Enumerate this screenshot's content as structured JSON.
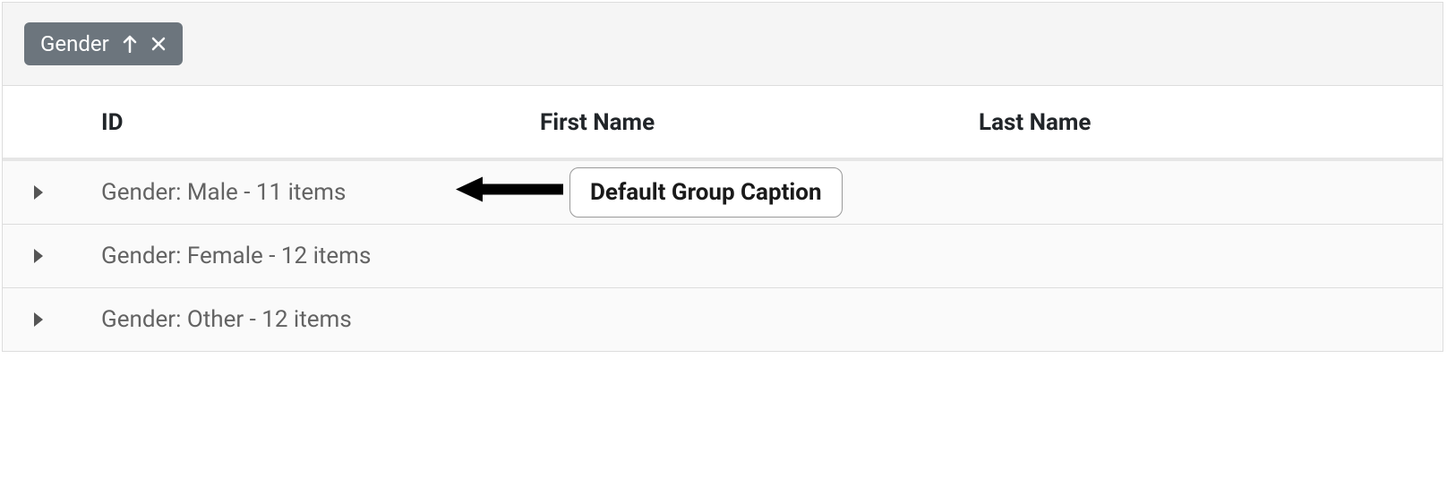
{
  "group_panel": {
    "chip": {
      "label": "Gender",
      "sort_icon": "arrow-up",
      "remove_icon": "close"
    }
  },
  "columns": {
    "id": "ID",
    "first_name": "First Name",
    "last_name": "Last Name"
  },
  "groups": [
    {
      "caption": "Gender: Male - 11 items"
    },
    {
      "caption": "Gender: Female - 12 items"
    },
    {
      "caption": "Gender: Other - 12 items"
    }
  ],
  "annotation": {
    "label": "Default Group Caption"
  }
}
